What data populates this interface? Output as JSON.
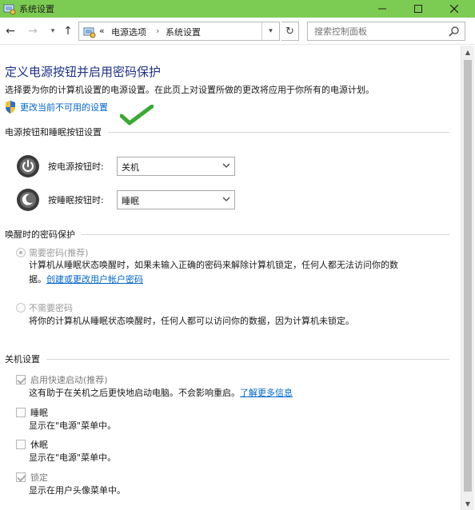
{
  "window": {
    "title": "系统设置"
  },
  "address": {
    "overflow": "«",
    "crumbs": [
      "电源选项",
      "系统设置"
    ],
    "search_placeholder": "搜索控制面板"
  },
  "page": {
    "heading": "定义电源按钮并启用密码保护",
    "description": "选择要为你的计算机设置的电源设置。在此页上对设置所做的更改将应用于你所有的电源计划。",
    "change_link": "更改当前不可用的设置"
  },
  "buttons_section": {
    "title": "电源按钮和睡眠按钮设置",
    "power_label": "按电源按钮时:",
    "power_value": "关机",
    "sleep_label": "按睡眠按钮时:",
    "sleep_value": "睡眠"
  },
  "password_section": {
    "title": "唤醒时的密码保护",
    "require_label": "需要密码(推荐)",
    "require_desc_1": "计算机从睡眠状态唤醒时，如果未输入正确的密码来解除计算机锁定，任何人都无法访问你的数",
    "require_desc_2_prefix": "据。",
    "require_link": "创建或更改用户帐户密码",
    "norequire_label": "不需要密码",
    "norequire_desc": "将你的计算机从睡眠状态唤醒时，任何人都可以访问你的数据，因为计算机未锁定。"
  },
  "shutdown_section": {
    "title": "关机设置",
    "fast_label": "启用快速启动(推荐)",
    "fast_desc": "这有助于在关机之后更快地启动电脑。不会影响重启。",
    "fast_link": "了解更多信息",
    "sleep_label": "睡眠",
    "sleep_desc": "显示在\"电源\"菜单中。",
    "hibernate_label": "休眠",
    "hibernate_desc": "显示在\"电源\"菜单中。",
    "lock_label": "锁定",
    "lock_desc": "显示在用户头像菜单中。"
  },
  "colors": {
    "titlebar": "#7ccb52",
    "heading": "#1e3287",
    "link": "#0066cc",
    "checkmark": "#3aaa35"
  }
}
